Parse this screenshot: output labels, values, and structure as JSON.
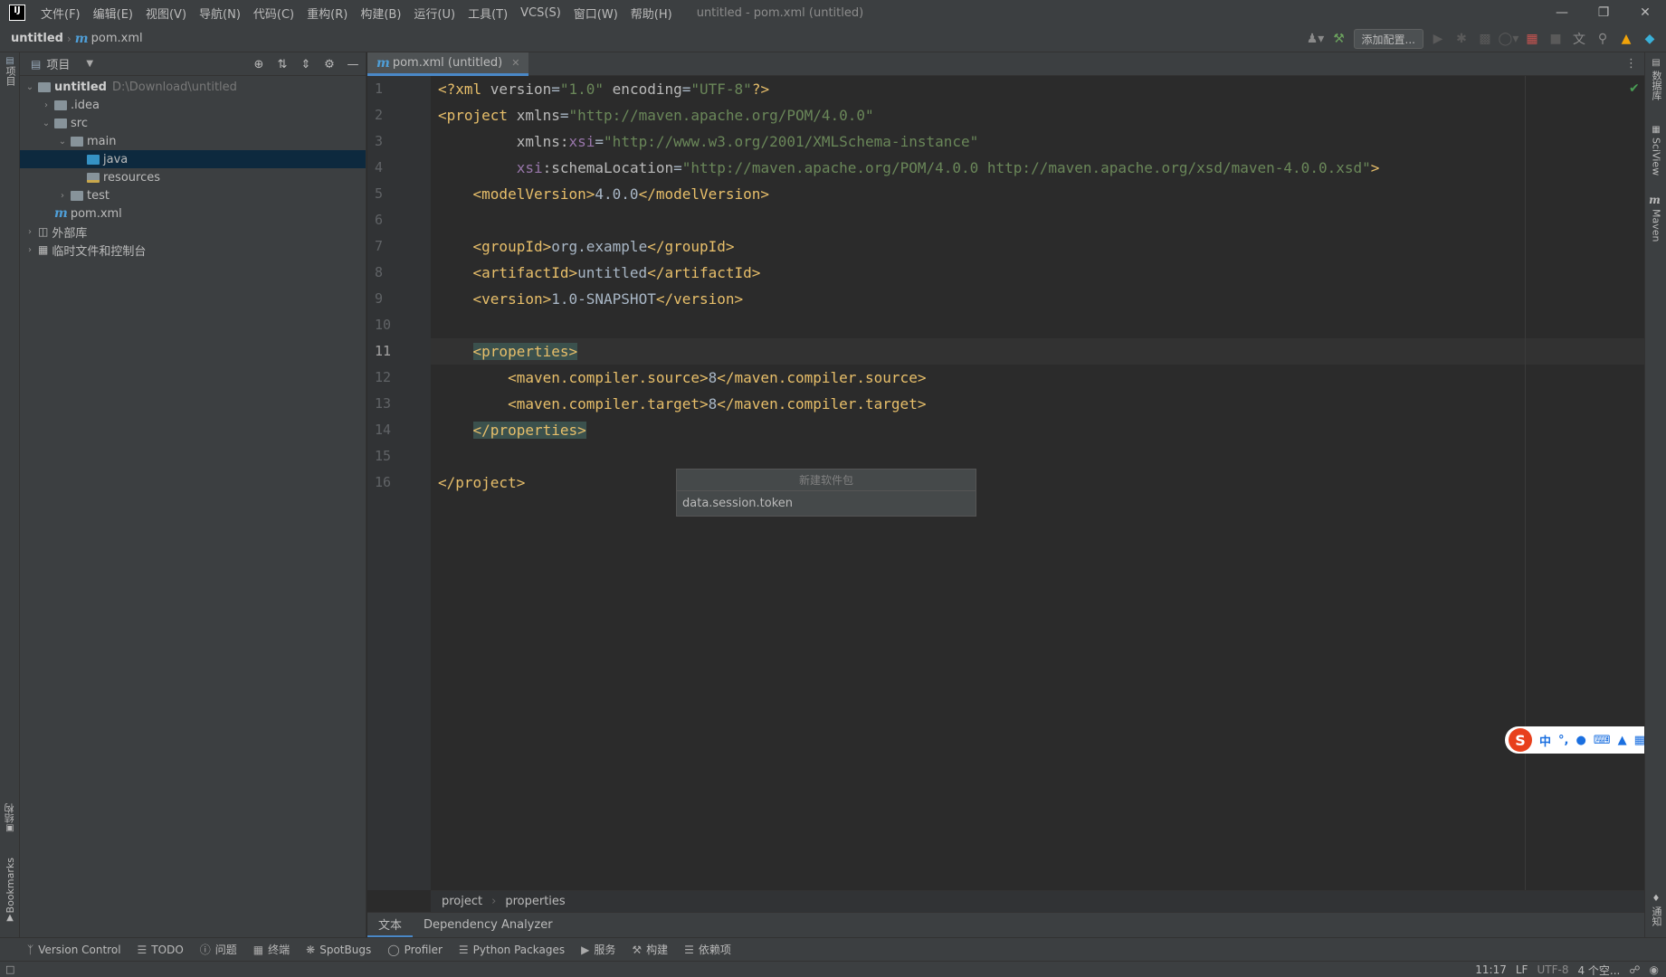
{
  "titlebar": {
    "logo": "IJ",
    "menu": [
      "文件(F)",
      "编辑(E)",
      "视图(V)",
      "导航(N)",
      "代码(C)",
      "重构(R)",
      "构建(B)",
      "运行(U)",
      "工具(T)",
      "VCS(S)",
      "窗口(W)",
      "帮助(H)"
    ],
    "window_title": "untitled - pom.xml (untitled)",
    "controls": [
      "minimize-icon",
      "maximize-icon",
      "close-icon"
    ]
  },
  "navbar": {
    "project": "untitled",
    "file": "pom.xml",
    "add_config": "添加配置..."
  },
  "left_stripe": {
    "project": "项目",
    "structure": "结构",
    "bookmarks": "Bookmarks"
  },
  "project_panel": {
    "title": "项目",
    "tree": [
      {
        "label": "untitled",
        "hint": "D:\\Download\\untitled",
        "depth": 0,
        "expanded": true,
        "icon": "module-folder"
      },
      {
        "label": ".idea",
        "depth": 1,
        "expanded": false,
        "icon": "folder"
      },
      {
        "label": "src",
        "depth": 1,
        "expanded": true,
        "icon": "folder"
      },
      {
        "label": "main",
        "depth": 2,
        "expanded": true,
        "icon": "folder"
      },
      {
        "label": "java",
        "depth": 3,
        "icon": "source-folder",
        "selected": true
      },
      {
        "label": "resources",
        "depth": 3,
        "icon": "resources-folder"
      },
      {
        "label": "test",
        "depth": 2,
        "expanded": false,
        "icon": "folder"
      },
      {
        "label": "pom.xml",
        "depth": 1,
        "icon": "maven-file"
      },
      {
        "label": "外部库",
        "depth": 0,
        "expanded": false,
        "icon": "library"
      },
      {
        "label": "临时文件和控制台",
        "depth": 0,
        "expanded": false,
        "icon": "scratch"
      }
    ]
  },
  "editor": {
    "tab": "pom.xml (untitled)",
    "current_line": 11,
    "line_numbers": [
      "1",
      "2",
      "3",
      "4",
      "5",
      "6",
      "7",
      "8",
      "9",
      "10",
      "11",
      "12",
      "13",
      "14",
      "15",
      "16"
    ],
    "breadcrumb": [
      "project",
      "properties"
    ]
  },
  "popup": {
    "title": "新建软件包",
    "value": "data.session.token"
  },
  "bottom_editor_tabs": [
    "文本",
    "Dependency Analyzer"
  ],
  "tool_windows": [
    "Version Control",
    "TODO",
    "问题",
    "终端",
    "SpotBugs",
    "Profiler",
    "Python Packages",
    "服务",
    "构建",
    "依赖项"
  ],
  "status": {
    "position": "11:17",
    "line_sep": "LF",
    "encoding": "UTF-8",
    "indent": "4 个空..."
  },
  "right_stripe": [
    "数据库",
    "SciView",
    "Maven",
    "通知"
  ],
  "ime": {
    "lang": "中"
  }
}
